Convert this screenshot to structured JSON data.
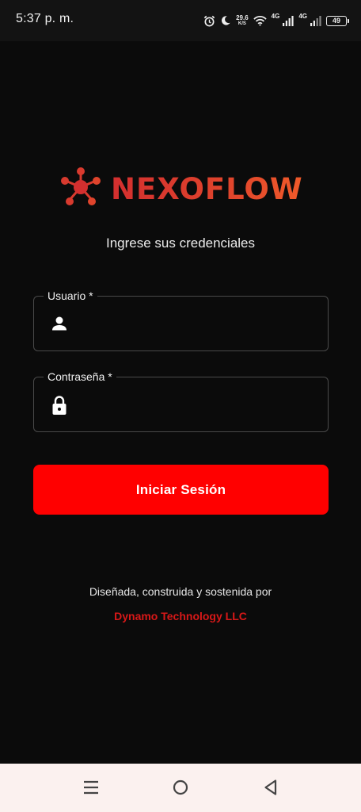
{
  "status_bar": {
    "time": "5:37 p. m.",
    "net_speed": "29.6",
    "net_speed_unit": "K/S",
    "sim1_network": "4G",
    "sim2_network": "4G",
    "battery_level": "49",
    "icons": [
      "alarm-icon",
      "moon-icon",
      "wifi-icon",
      "signal-icon",
      "signal-icon",
      "battery-icon"
    ]
  },
  "brand": {
    "name": "NEXOFLOW",
    "logo_icon": "network-nodes-icon",
    "color_start": "#d32f2f",
    "color_end": "#ef5a2a"
  },
  "login": {
    "subtitle": "Ingrese sus credenciales",
    "username": {
      "label": "Usuario *",
      "value": "",
      "icon": "person-icon"
    },
    "password": {
      "label": "Contraseña *",
      "value": "",
      "icon": "lock-icon"
    },
    "submit_label": "Iniciar Sesión",
    "button_color": "#ff0000"
  },
  "footer": {
    "credit_text": "Diseñada, construida y sostenida por",
    "company": "Dynamo Technology LLC",
    "company_color": "#d81818"
  },
  "nav_bar": {
    "buttons": [
      "menu-icon",
      "home-icon",
      "back-icon"
    ]
  }
}
